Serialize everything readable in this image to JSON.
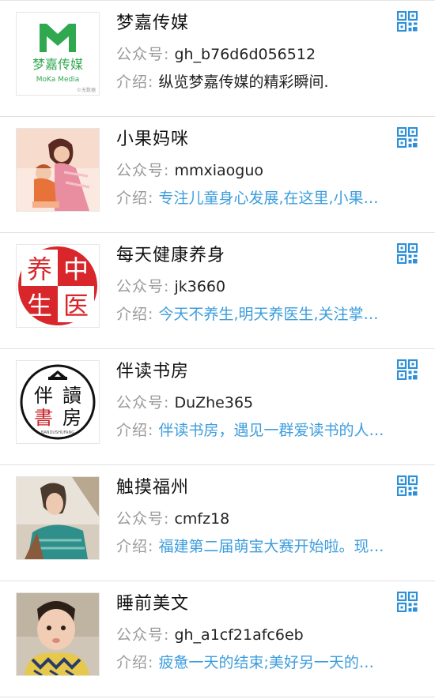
{
  "accounts": [
    {
      "name": "梦嘉传媒",
      "id_label": "公众号:",
      "id": "gh_b76d6d056512",
      "intro_label": "介绍:",
      "intro": "纵览梦嘉传媒的精彩瞬间.",
      "intro_is_link": false,
      "avatar": {
        "logo_text": "梦嘉传媒",
        "logo_sub": "MoKa Media",
        "watermark": "©无数据"
      }
    },
    {
      "name": "小果妈咪",
      "id_label": "公众号:",
      "id": "mmxiaoguo",
      "intro_label": "介绍:",
      "intro": "专注儿童身心发展,在这里,小果…",
      "intro_is_link": true
    },
    {
      "name": "每天健康养身",
      "id_label": "公众号:",
      "id": "jk3660",
      "intro_label": "介绍:",
      "intro": "今天不养生,明天养医生,关注掌…",
      "intro_is_link": true,
      "avatar": {
        "seal_chars": [
          "养",
          "中",
          "生",
          "医"
        ]
      }
    },
    {
      "name": "伴读书房",
      "id_label": "公众号:",
      "id": "DuZhe365",
      "intro_label": "介绍:",
      "intro": "伴读书房，遇见一群爱读书的人…",
      "intro_is_link": true,
      "avatar": {
        "chars": [
          "伴",
          "讀",
          "書",
          "房"
        ],
        "sub": "BANDUSHUFANG"
      }
    },
    {
      "name": "触摸福州",
      "id_label": "公众号:",
      "id": "cmfz18",
      "intro_label": "介绍:",
      "intro": "福建第二届萌宝大赛开始啦。现…",
      "intro_is_link": true
    },
    {
      "name": "睡前美文",
      "id_label": "公众号:",
      "id": "gh_a1cf21afc6eb",
      "intro_label": "介绍:",
      "intro": "疲惫一天的结束;美好另一天的…",
      "intro_is_link": true
    }
  ],
  "colors": {
    "link": "#3d9ddd",
    "label": "#9a9a9a",
    "qr": "#2e8fd6",
    "moka_green": "#2fa84f",
    "seal_red": "#d8262b"
  },
  "icons": {
    "qr": "qr-code-icon"
  }
}
